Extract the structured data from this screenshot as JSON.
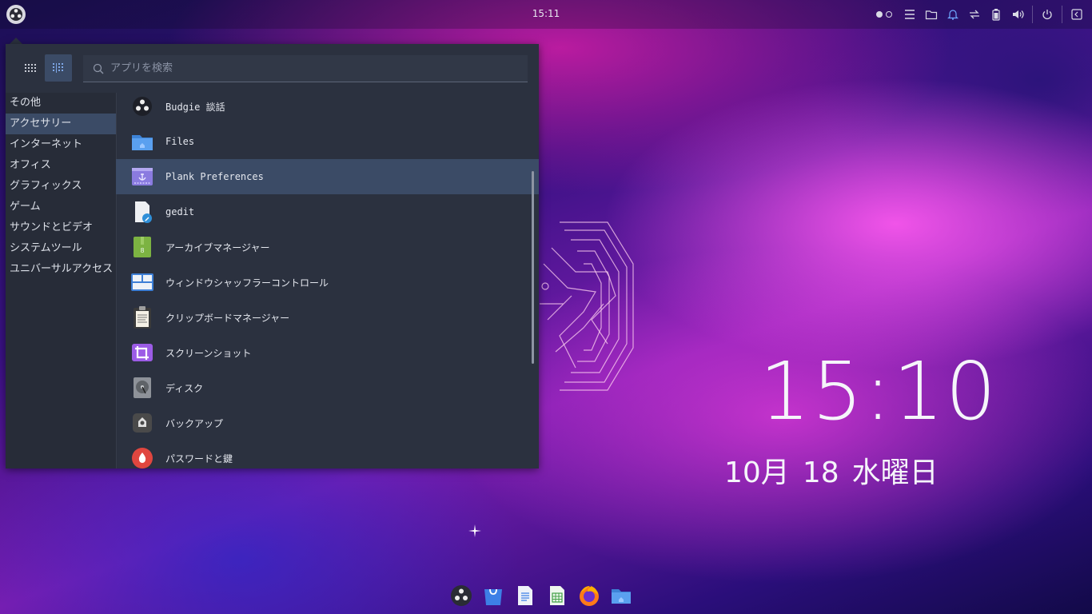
{
  "topbar": {
    "clock": "15:11",
    "tray_icons": [
      "workspace-dots-icon",
      "raven-menu-icon",
      "files-folder-icon",
      "notification-bell-icon",
      "network-transfer-icon",
      "battery-icon",
      "volume-icon",
      "power-icon",
      "raven-toggle-icon"
    ]
  },
  "menu": {
    "search_placeholder": "アプリを検索",
    "categories": [
      {
        "label": "その他"
      },
      {
        "label": "アクセサリー"
      },
      {
        "label": "インターネット"
      },
      {
        "label": "オフィス"
      },
      {
        "label": "グラフィックス"
      },
      {
        "label": "ゲーム"
      },
      {
        "label": "サウンドとビデオ"
      },
      {
        "label": "システムツール"
      },
      {
        "label": "ユニバーサルアクセス"
      }
    ],
    "selected_category": "アクセサリー",
    "apps": [
      {
        "label": "Budgie 談話",
        "icon": "budgie-icon"
      },
      {
        "label": "Files",
        "icon": "files-folder-icon"
      },
      {
        "label": "Plank Preferences",
        "icon": "plank-icon"
      },
      {
        "label": "gedit",
        "icon": "gedit-icon"
      },
      {
        "label": "アーカイブマネージャー",
        "icon": "archive-icon"
      },
      {
        "label": "ウィンドウシャッフラーコントロール",
        "icon": "window-shuffler-icon"
      },
      {
        "label": "クリップボードマネージャー",
        "icon": "clipboard-icon"
      },
      {
        "label": "スクリーンショット",
        "icon": "screenshot-icon"
      },
      {
        "label": "ディスク",
        "icon": "disk-icon"
      },
      {
        "label": "バックアップ",
        "icon": "backup-icon"
      },
      {
        "label": "パスワードと鍵",
        "icon": "password-icon"
      }
    ],
    "selected_app": "Plank Preferences"
  },
  "desktop": {
    "clock": "15:10",
    "date_month": "10月",
    "date_day": "18",
    "date_weekday": "水曜日"
  },
  "dock": {
    "items": [
      "budgie-icon",
      "software-store-icon",
      "text-document-icon",
      "spreadsheet-icon",
      "firefox-icon",
      "files-folder-icon"
    ]
  },
  "colors": {
    "menu_bg": "#2b313f",
    "selection": "#3b4b66",
    "accent_pink": "#ff5af0"
  }
}
